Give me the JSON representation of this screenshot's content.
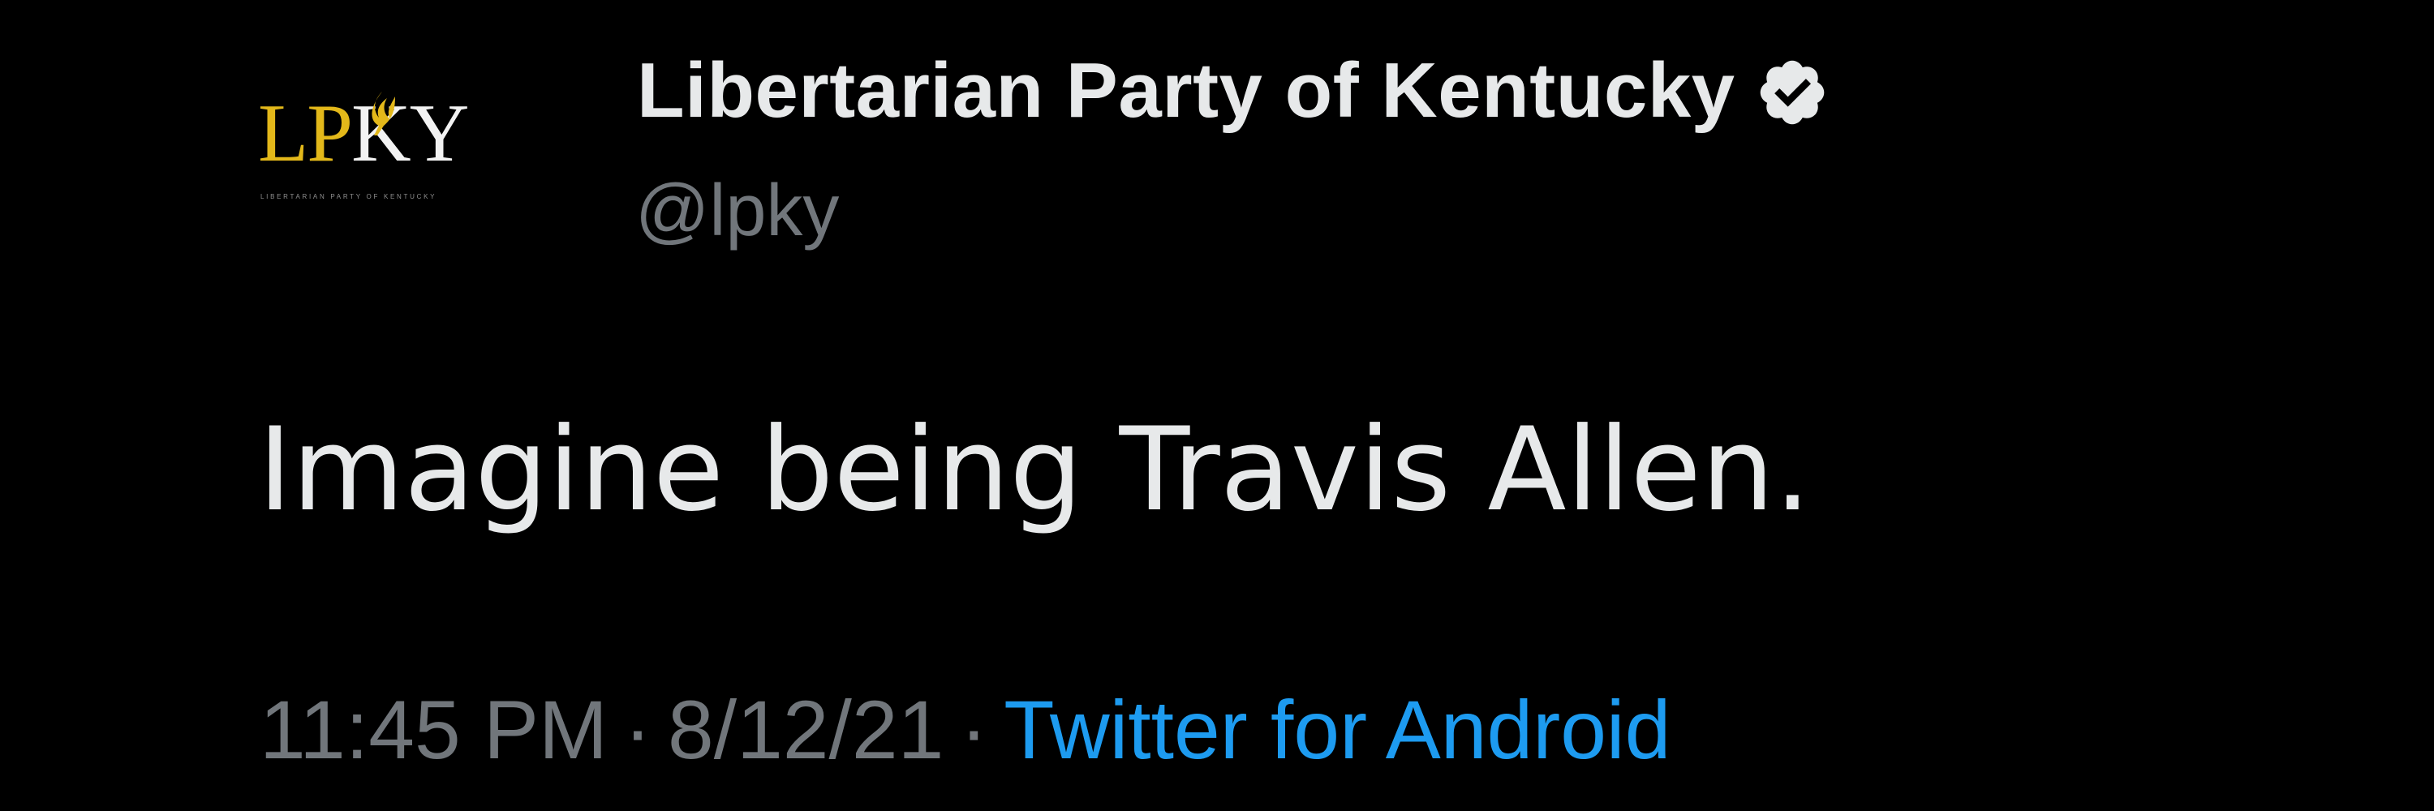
{
  "tweet": {
    "author": {
      "display_name": "Libertarian Party of Kentucky",
      "handle": "@lpky",
      "verified": true,
      "avatar": {
        "logo_letters": [
          "LP",
          "KY"
        ],
        "logo_subtitle": "LIBERTARIAN PARTY OF KENTUCKY",
        "icon": "torch-icon"
      }
    },
    "text": "Imagine being Travis Allen.",
    "meta": {
      "time": "11:45 PM",
      "separator": "·",
      "date": "8/12/21",
      "source": "Twitter for Android"
    }
  },
  "colors": {
    "background": "#000000",
    "primary_text": "#e7e9ea",
    "secondary_text": "#71767b",
    "link": "#1d9bf0",
    "logo_gold": "#e3b81a",
    "verified_badge": "#e7e9ea"
  }
}
